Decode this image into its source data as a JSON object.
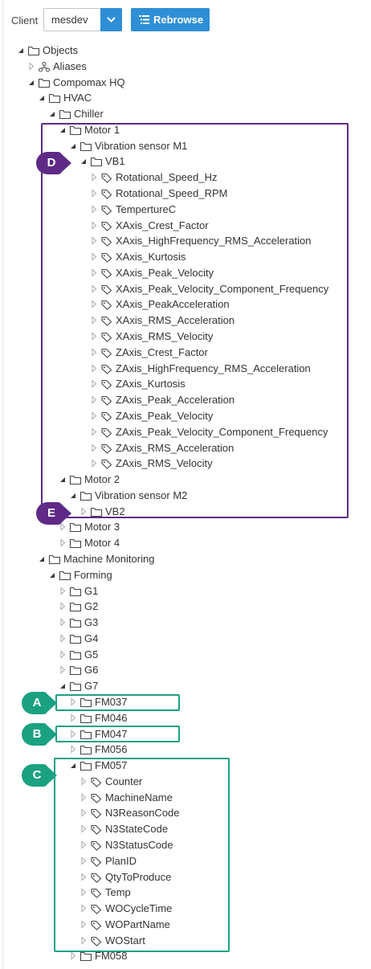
{
  "toolbar": {
    "client_label": "Client",
    "client_value": "mesdev",
    "rebrowse_label": "Rebrowse"
  },
  "colors": {
    "accent": "#2f8fd6",
    "callout_purple": "#5f2a86",
    "callout_green": "#1aa181"
  },
  "tree": [
    {
      "label": "Objects",
      "level": 0,
      "type": "folder",
      "state": "expanded"
    },
    {
      "label": "Aliases",
      "level": 1,
      "type": "alias",
      "state": "collapsed"
    },
    {
      "label": "Compomax HQ",
      "level": 1,
      "type": "folder",
      "state": "expanded"
    },
    {
      "label": "HVAC",
      "level": 2,
      "type": "folder",
      "state": "expanded"
    },
    {
      "label": "Chiller",
      "level": 3,
      "type": "folder",
      "state": "expanded"
    },
    {
      "label": "Motor 1",
      "level": 4,
      "type": "folder",
      "state": "expanded"
    },
    {
      "label": "Vibration sensor M1",
      "level": 5,
      "type": "folder",
      "state": "expanded"
    },
    {
      "label": "VB1",
      "level": 6,
      "type": "folder",
      "state": "expanded"
    },
    {
      "label": "Rotational_Speed_Hz",
      "level": 7,
      "type": "tag",
      "state": "collapsed"
    },
    {
      "label": "Rotational_Speed_RPM",
      "level": 7,
      "type": "tag",
      "state": "collapsed"
    },
    {
      "label": "TempertureC",
      "level": 7,
      "type": "tag",
      "state": "collapsed"
    },
    {
      "label": "XAxis_Crest_Factor",
      "level": 7,
      "type": "tag",
      "state": "collapsed"
    },
    {
      "label": "XAxis_HighFrequency_RMS_Acceleration",
      "level": 7,
      "type": "tag",
      "state": "collapsed"
    },
    {
      "label": "XAxis_Kurtosis",
      "level": 7,
      "type": "tag",
      "state": "collapsed"
    },
    {
      "label": "XAxis_Peak_Velocity",
      "level": 7,
      "type": "tag",
      "state": "collapsed"
    },
    {
      "label": "XAxis_Peak_Velocity_Component_Frequency",
      "level": 7,
      "type": "tag",
      "state": "collapsed"
    },
    {
      "label": "XAxis_PeakAcceleration",
      "level": 7,
      "type": "tag",
      "state": "collapsed"
    },
    {
      "label": "XAxis_RMS_Acceleration",
      "level": 7,
      "type": "tag",
      "state": "collapsed"
    },
    {
      "label": "XAxis_RMS_Velocity",
      "level": 7,
      "type": "tag",
      "state": "collapsed"
    },
    {
      "label": "ZAxis_Crest_Factor",
      "level": 7,
      "type": "tag",
      "state": "collapsed"
    },
    {
      "label": "ZAxis_HighFrequency_RMS_Acceleration",
      "level": 7,
      "type": "tag",
      "state": "collapsed"
    },
    {
      "label": "ZAxis_Kurtosis",
      "level": 7,
      "type": "tag",
      "state": "collapsed"
    },
    {
      "label": "ZAxis_Peak_Acceleration",
      "level": 7,
      "type": "tag",
      "state": "collapsed"
    },
    {
      "label": "ZAxis_Peak_Velocity",
      "level": 7,
      "type": "tag",
      "state": "collapsed"
    },
    {
      "label": "ZAxis_Peak_Velocity_Component_Frequency",
      "level": 7,
      "type": "tag",
      "state": "collapsed"
    },
    {
      "label": "ZAxis_RMS_Acceleration",
      "level": 7,
      "type": "tag",
      "state": "collapsed"
    },
    {
      "label": "ZAxis_RMS_Velocity",
      "level": 7,
      "type": "tag",
      "state": "collapsed"
    },
    {
      "label": "Motor 2",
      "level": 4,
      "type": "folder",
      "state": "expanded"
    },
    {
      "label": "Vibration sensor M2",
      "level": 5,
      "type": "folder",
      "state": "expanded"
    },
    {
      "label": "VB2",
      "level": 6,
      "type": "folder",
      "state": "collapsed"
    },
    {
      "label": "Motor 3",
      "level": 4,
      "type": "folder",
      "state": "collapsed"
    },
    {
      "label": "Motor 4",
      "level": 4,
      "type": "folder",
      "state": "collapsed"
    },
    {
      "label": "Machine Monitoring",
      "level": 2,
      "type": "folder",
      "state": "expanded"
    },
    {
      "label": "Forming",
      "level": 3,
      "type": "folder",
      "state": "expanded"
    },
    {
      "label": "G1",
      "level": 4,
      "type": "folder",
      "state": "collapsed"
    },
    {
      "label": "G2",
      "level": 4,
      "type": "folder",
      "state": "collapsed"
    },
    {
      "label": "G3",
      "level": 4,
      "type": "folder",
      "state": "collapsed"
    },
    {
      "label": "G4",
      "level": 4,
      "type": "folder",
      "state": "collapsed"
    },
    {
      "label": "G5",
      "level": 4,
      "type": "folder",
      "state": "collapsed"
    },
    {
      "label": "G6",
      "level": 4,
      "type": "folder",
      "state": "collapsed"
    },
    {
      "label": "G7",
      "level": 4,
      "type": "folder",
      "state": "expanded"
    },
    {
      "label": "FM037",
      "level": 5,
      "type": "folder",
      "state": "collapsed"
    },
    {
      "label": "FM046",
      "level": 5,
      "type": "folder",
      "state": "collapsed"
    },
    {
      "label": "FM047",
      "level": 5,
      "type": "folder",
      "state": "collapsed"
    },
    {
      "label": "FM056",
      "level": 5,
      "type": "folder",
      "state": "collapsed"
    },
    {
      "label": "FM057",
      "level": 5,
      "type": "folder",
      "state": "expanded"
    },
    {
      "label": "Counter",
      "level": 6,
      "type": "tag",
      "state": "collapsed"
    },
    {
      "label": "MachineName",
      "level": 6,
      "type": "tag",
      "state": "collapsed"
    },
    {
      "label": "N3ReasonCode",
      "level": 6,
      "type": "tag",
      "state": "collapsed"
    },
    {
      "label": "N3StateCode",
      "level": 6,
      "type": "tag",
      "state": "collapsed"
    },
    {
      "label": "N3StatusCode",
      "level": 6,
      "type": "tag",
      "state": "collapsed"
    },
    {
      "label": "PlanID",
      "level": 6,
      "type": "tag",
      "state": "collapsed"
    },
    {
      "label": "QtyToProduce",
      "level": 6,
      "type": "tag",
      "state": "collapsed"
    },
    {
      "label": "Temp",
      "level": 6,
      "type": "tag",
      "state": "collapsed"
    },
    {
      "label": "WOCycleTime",
      "level": 6,
      "type": "tag",
      "state": "collapsed"
    },
    {
      "label": "WOPartName",
      "level": 6,
      "type": "tag",
      "state": "collapsed"
    },
    {
      "label": "WOStart",
      "level": 6,
      "type": "tag",
      "state": "collapsed"
    },
    {
      "label": "FM058",
      "level": 5,
      "type": "folder",
      "state": "collapsed"
    }
  ],
  "callouts": [
    {
      "letter": "D",
      "color": "purple",
      "target": "VB1"
    },
    {
      "letter": "E",
      "color": "purple",
      "target": "VB2"
    },
    {
      "letter": "A",
      "color": "green",
      "target": "FM037"
    },
    {
      "letter": "B",
      "color": "green",
      "target": "FM047"
    },
    {
      "letter": "C",
      "color": "green",
      "target": "FM057"
    }
  ]
}
